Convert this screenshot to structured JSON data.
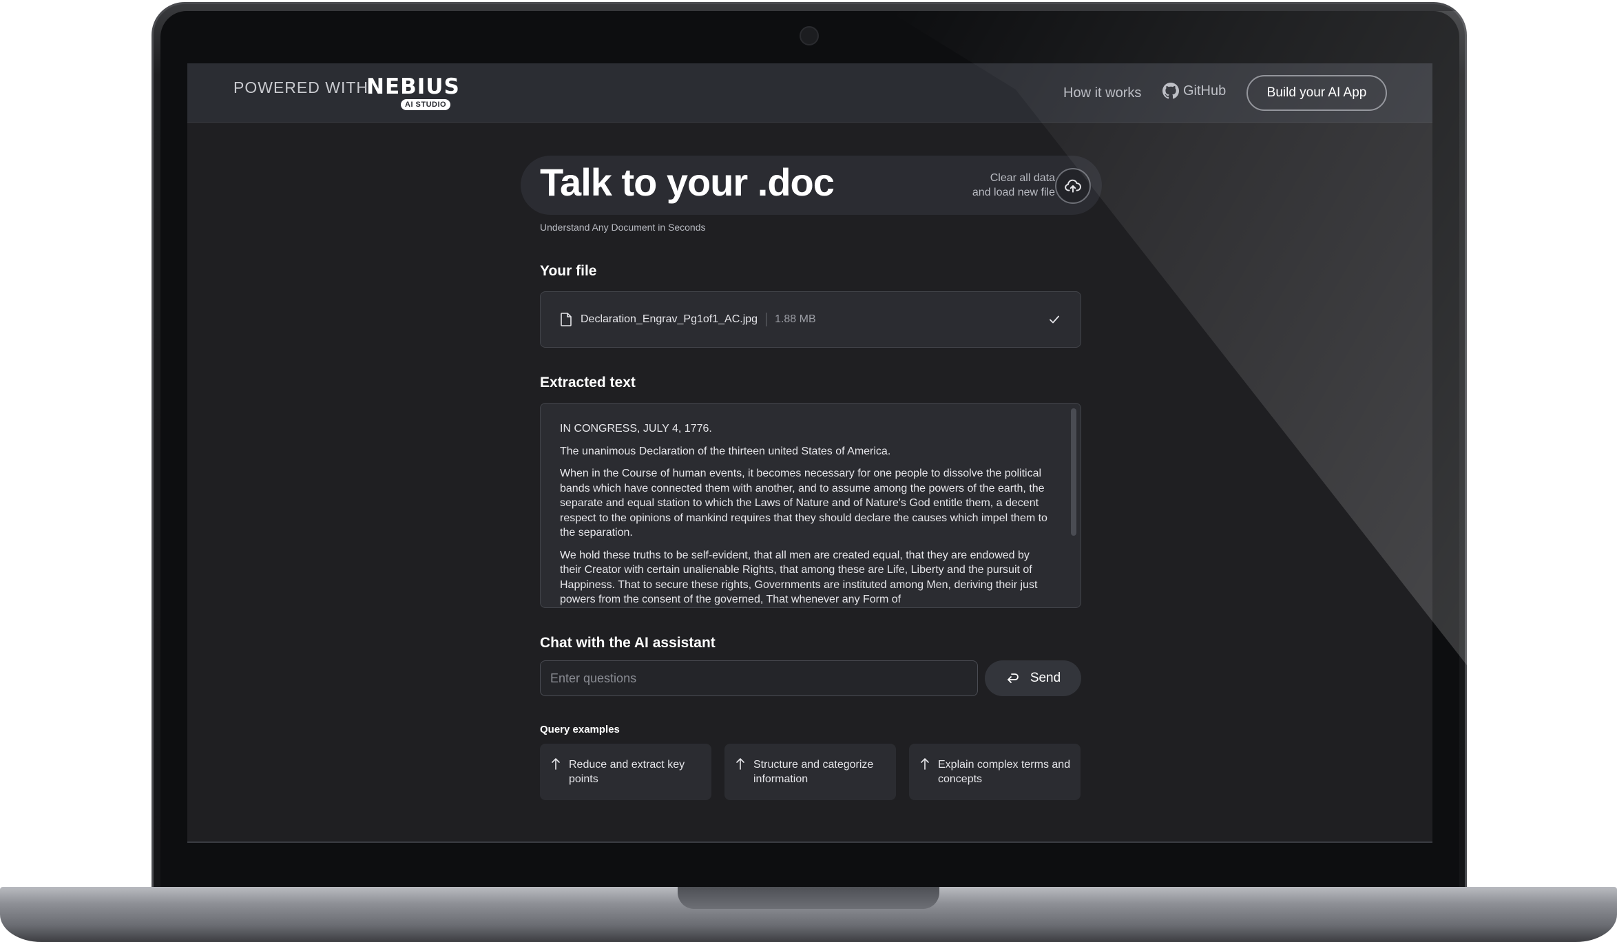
{
  "header": {
    "powered_label": "POWERED WITH",
    "brand_name": "NEBIUS",
    "brand_sub": "AI STUDIO",
    "nav": {
      "how_it_works": "How it works",
      "github": "GitHub"
    },
    "build_button": "Build your AI App"
  },
  "hero": {
    "title": "Talk to your .doc",
    "clear_line1": "Clear all data",
    "clear_line2": "and load new file",
    "subtitle": "Understand Any Document in Seconds"
  },
  "file_section": {
    "label": "Your file",
    "file_name": "Declaration_Engrav_Pg1of1_AC.jpg",
    "file_size": "1.88 MB"
  },
  "extract_section": {
    "label": "Extracted text",
    "paragraphs": [
      "IN CONGRESS, JULY 4, 1776.",
      "The unanimous Declaration of the thirteen united States of America.",
      "When in the Course of human events, it becomes necessary for one people to dissolve the political bands which have connected them with another, and to assume among the powers of the earth, the separate and equal station to which the Laws of Nature and of Nature's God entitle them, a decent respect to the opinions of mankind requires that they should declare the causes which impel them to the separation.",
      "We hold these truths to be self-evident, that all men are created equal, that they are endowed by their Creator with certain unalienable Rights, that among these are Life, Liberty and the pursuit of Happiness. That to secure these rights, Governments are instituted among Men, deriving their just powers from the consent of the governed, That whenever any Form of"
    ]
  },
  "chat_section": {
    "label": "Chat with the AI assistant",
    "input_placeholder": "Enter questions",
    "input_value": "",
    "send_label": "Send"
  },
  "query_examples": {
    "label": "Query examples",
    "items": [
      "Reduce and extract key points",
      "Structure and categorize information",
      "Explain complex terms and concepts"
    ]
  },
  "icons": {
    "upload": "cloud-upload-icon",
    "file": "file-icon",
    "check": "check-icon",
    "send": "return-arrow-icon",
    "query": "arrow-up-icon",
    "github": "github-icon"
  },
  "colors": {
    "screen_bg": "#1f1f22",
    "topbar_bg": "#2b2d33",
    "card_bg": "#2b2c31",
    "text_primary": "#ffffff",
    "text_muted": "#b9bbc2"
  }
}
